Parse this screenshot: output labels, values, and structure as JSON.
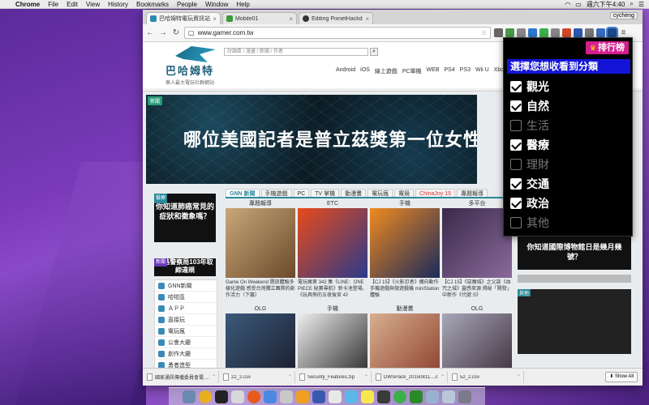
{
  "menubar": {
    "app": "Chrome",
    "items": [
      "File",
      "Edit",
      "View",
      "History",
      "Bookmarks",
      "People",
      "Window",
      "Help"
    ],
    "clock": "週六下午4:40"
  },
  "browser": {
    "tabs": [
      {
        "label": "巴哈姆特電玩資訊站",
        "color": "#2a8ab0",
        "active": true
      },
      {
        "label": "Mobile01",
        "color": "#3a9a3a",
        "active": false
      },
      {
        "label": "Editing PixnetHackday201",
        "color": "#333333",
        "active": false
      }
    ],
    "user": "cycheng",
    "url": "www.gamer.com.tw"
  },
  "site": {
    "logo_name": "巴哈姆特",
    "slogan": "華人最大電玩社群網站",
    "search_placeholder": "討論區 / 漫畫 / 新聞 / 作者",
    "nav": [
      "Android",
      "iOS",
      "線上遊戲",
      "PC單機",
      "WEB",
      "PS4",
      "PS3",
      "Wii U",
      "Xbox"
    ],
    "banner_tag": "新聞",
    "banner_headline": "哪位美國記者是普立茲獎第一位女性"
  },
  "left": {
    "promo_tag": "醫療",
    "promo_text": "你知道肺癌常見的症狀和徵象嗎？",
    "promo2_tag": "新聞",
    "promo2_text": "公路警察局103年取締違規",
    "menu": [
      "GNN新聞",
      "哈啦區",
      "ＡＰＰ",
      "直接玩",
      "電玩瘋",
      "公會大廳",
      "創作大廳",
      "勇者造型"
    ]
  },
  "gnn": {
    "tabs": [
      "GNN 新聞",
      "手機遊戲",
      "PC",
      "TV 掌機",
      "動漫畫",
      "電玩瘋",
      "電競",
      "ChinaJoy 15",
      "專題報導"
    ],
    "cards": [
      {
        "cat": "專題報導",
        "cap": "Game On Weekend 開放體驗多樣化遊戲 感受台灣獨立團隊的創作活力（下篇）",
        "c1": "#c9a77a",
        "c2": "#6a4a2a"
      },
      {
        "cat": "ETC",
        "cap": "電玩瘋第 342 集《LINE：ONE PIECE 秘寶尋航》新卡池登場、《玩具熊的五夜後宮 4》",
        "c1": "#e84a1a",
        "c2": "#2a3a8a"
      },
      {
        "cat": "手機",
        "cap": "【CJ 15】《火影忍者》橫向動作手機遊戲與微遊戲機 miniStation 體驗",
        "c1": "#f08a20",
        "c2": "#1a2a5a"
      },
      {
        "cat": "多平台",
        "cap": "【CJ 15】《惡魔城》之父談《血咒之城》靈感來源 揭秘「開發」中新作《代號 S》",
        "c1": "#3a2a4a",
        "c2": "#8a6a9a"
      }
    ],
    "cards2": [
      {
        "cat": "OLG",
        "c1": "#3a5a7a",
        "c2": "#1a1a2a"
      },
      {
        "cat": "手機",
        "c1": "#eeeeee",
        "c2": "#222222"
      },
      {
        "cat": "動漫畫",
        "c1": "#d8b090",
        "c2": "#8a3a2a"
      },
      {
        "cat": "OLG",
        "c1": "#a8a8b8",
        "c2": "#3a2a3a"
      }
    ]
  },
  "right": {
    "promo_text": "你知道國際博物館日是幾月幾號？",
    "promo2_tag": "其他"
  },
  "downloads": [
    "國家通訊傳播委員會電....csv",
    "22_2.csv",
    "Security_Features.zip",
    "DWSPack_20150811....csv",
    "52_2.csv"
  ],
  "downloads_show_all": "Show All",
  "popup": {
    "rank_label": "排行榜",
    "title": "選擇您想收看到分類",
    "options": [
      {
        "label": "觀光",
        "checked": true
      },
      {
        "label": "自然",
        "checked": true
      },
      {
        "label": "生活",
        "checked": false
      },
      {
        "label": "醫療",
        "checked": true
      },
      {
        "label": "理財",
        "checked": false
      },
      {
        "label": "交通",
        "checked": true
      },
      {
        "label": "政治",
        "checked": true
      },
      {
        "label": "其他",
        "checked": false
      }
    ]
  }
}
